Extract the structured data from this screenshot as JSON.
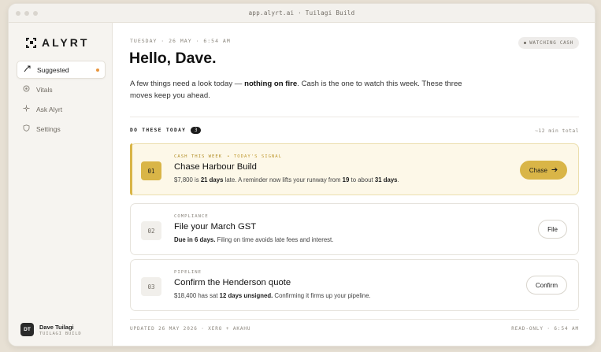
{
  "window": {
    "title": "app.alyrt.ai · Tuilagi Build"
  },
  "brand": {
    "name": "ALYRT",
    "icon": "alyrt-logo-icon"
  },
  "sidebar": {
    "items": [
      {
        "label": "Suggested",
        "icon": "sparkle-arrow-icon",
        "active": true,
        "has_dot": true
      },
      {
        "label": "Vitals",
        "icon": "target-icon",
        "active": false
      },
      {
        "label": "Ask Alyrt",
        "icon": "sparkle-icon",
        "active": false
      },
      {
        "label": "Settings",
        "icon": "shield-icon",
        "active": false
      }
    ],
    "user": {
      "initials": "DT",
      "name": "Dave Tuilagi",
      "org": "TUILAGI BUILD"
    }
  },
  "header": {
    "date": "TUESDAY · 26 MAY · 6:54 AM",
    "watch_badge": "WATCHING CASH",
    "greeting": "Hello, Dave.",
    "intro_before": "A few things need a look today — ",
    "intro_bold": "nothing on fire",
    "intro_after": ". Cash is the one to watch this week. These three moves keep you ahead."
  },
  "section": {
    "label": "DO THESE TODAY",
    "count": "3",
    "total": "~12 min total"
  },
  "cards": [
    {
      "num": "01",
      "eyebrow": "CASH THIS WEEK",
      "signal": "• TODAY'S SIGNAL",
      "title": "Chase Harbour Build",
      "desc_parts": [
        "$7,800 is ",
        "21 days",
        " late. A reminder now lifts your runway from ",
        "19",
        " to about ",
        "31 days",
        "."
      ],
      "action": "Chase",
      "action_icon": "arrow-right-icon"
    },
    {
      "num": "02",
      "eyebrow": "COMPLIANCE",
      "title": "File your March GST",
      "desc_parts": [
        "Due in 6 days.",
        " Filing on time avoids late fees and interest."
      ],
      "action": "File"
    },
    {
      "num": "03",
      "eyebrow": "PIPELINE",
      "title": "Confirm the Henderson quote",
      "desc_parts": [
        "$18,400 has sat ",
        "12 days unsigned.",
        " Confirming it firms up your pipeline."
      ],
      "action": "Confirm"
    }
  ],
  "footer": {
    "left": "UPDATED 26 MAY 2026 · XERO + AKAHU",
    "right": "READ-ONLY · 6:54 AM"
  },
  "colors": {
    "accent": "#d9b547",
    "highlight_bg": "#fdf8e8",
    "nav_dot": "#e8963f"
  }
}
